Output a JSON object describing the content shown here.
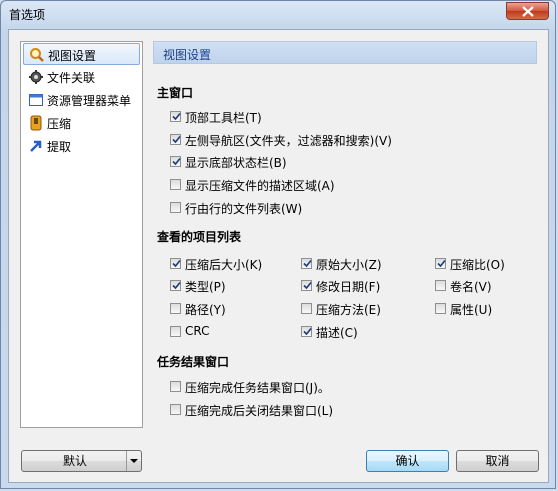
{
  "window": {
    "title": "首选项"
  },
  "sidebar": {
    "items": [
      {
        "label": "视图设置",
        "icon": "magnifier-icon",
        "selected": true
      },
      {
        "label": "文件关联",
        "icon": "gear-icon",
        "selected": false
      },
      {
        "label": "资源管理器菜单",
        "icon": "window-icon",
        "selected": false
      },
      {
        "label": "压缩",
        "icon": "compress-icon",
        "selected": false
      },
      {
        "label": "提取",
        "icon": "arrow-icon",
        "selected": false
      }
    ]
  },
  "panel": {
    "header": "视图设置",
    "main_window": {
      "title": "主窗口",
      "options": [
        {
          "label": "顶部工具栏(T)",
          "checked": true
        },
        {
          "label": "左侧导航区(文件夹，过滤器和搜索)(V)",
          "checked": true
        },
        {
          "label": "显示底部状态栏(B)",
          "checked": true
        },
        {
          "label": "显示压缩文件的描述区域(A)",
          "checked": false
        },
        {
          "label": "行由行的文件列表(W)",
          "checked": false
        }
      ]
    },
    "columns": {
      "title": "查看的项目列表",
      "options": [
        {
          "label": "压缩后大小(K)",
          "checked": true
        },
        {
          "label": "原始大小(Z)",
          "checked": true
        },
        {
          "label": "压缩比(O)",
          "checked": true
        },
        {
          "label": "类型(P)",
          "checked": true
        },
        {
          "label": "修改日期(F)",
          "checked": true
        },
        {
          "label": "卷名(V)",
          "checked": false
        },
        {
          "label": "路径(Y)",
          "checked": false
        },
        {
          "label": "压缩方法(E)",
          "checked": false
        },
        {
          "label": "属性(U)",
          "checked": false
        },
        {
          "label": "CRC",
          "checked": false
        },
        {
          "label": "描述(C)",
          "checked": true
        }
      ]
    },
    "task_result": {
      "title": "任务结果窗口",
      "options": [
        {
          "label": "压缩完成任务结果窗口(J)。",
          "checked": false
        },
        {
          "label": "压缩完成后关闭结果窗口(L)",
          "checked": false
        }
      ]
    }
  },
  "buttons": {
    "default": "默认",
    "ok": "确认",
    "cancel": "取消"
  },
  "colors": {
    "accent": "#3c7fb1",
    "header_text": "#1d3f8a"
  }
}
